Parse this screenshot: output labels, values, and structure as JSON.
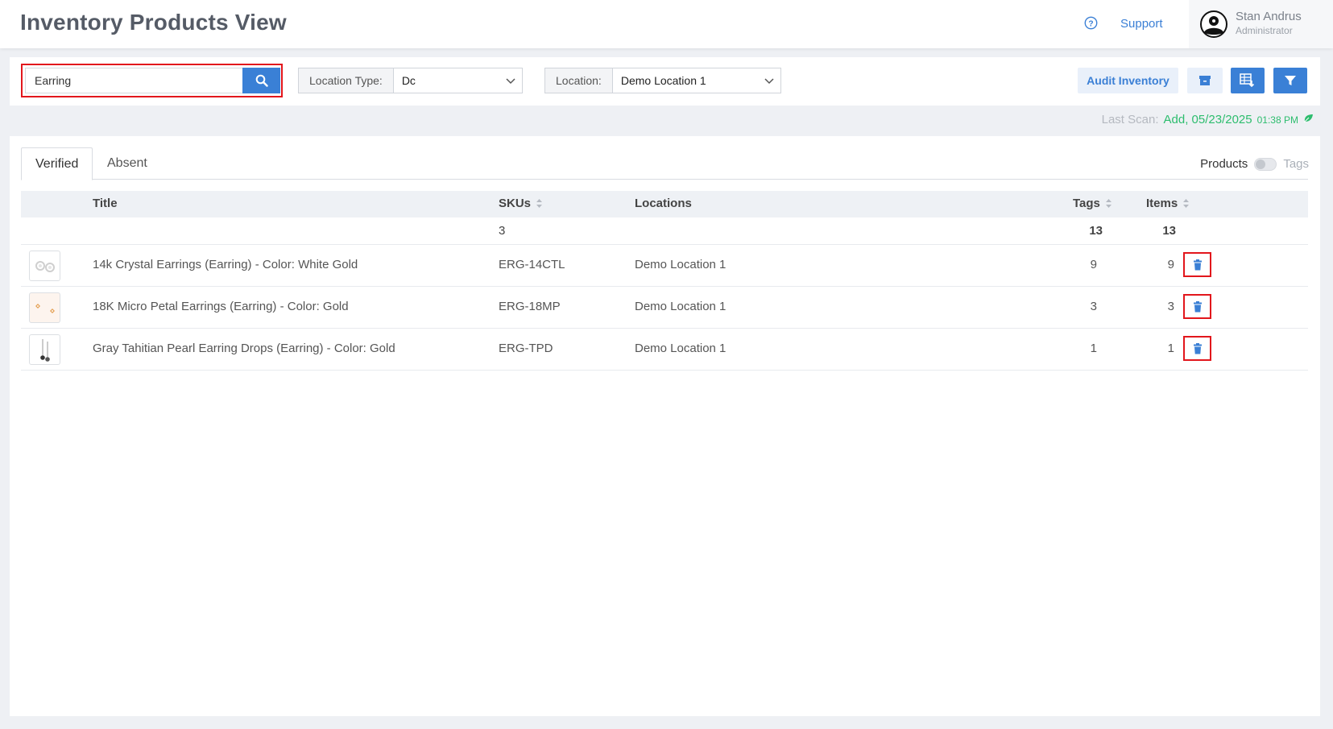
{
  "header": {
    "title": "Inventory Products View",
    "support_label": "Support",
    "user": {
      "name": "Stan Andrus",
      "role": "Administrator"
    }
  },
  "toolbar": {
    "search": {
      "value": "Earring",
      "placeholder": ""
    },
    "location_type": {
      "label": "Location Type:",
      "value": "Dc"
    },
    "location": {
      "label": "Location:",
      "value": "Demo Location 1"
    },
    "audit_label": "Audit Inventory"
  },
  "last_scan": {
    "label": "Last Scan:",
    "value": "Add, 05/23/2025",
    "time": "01:38 PM"
  },
  "tabs": [
    {
      "label": "Verified"
    },
    {
      "label": "Absent"
    }
  ],
  "view_toggle": {
    "left": "Products",
    "right": "Tags"
  },
  "table": {
    "columns": {
      "title": "Title",
      "skus": "SKUs",
      "locations": "Locations",
      "tags": "Tags",
      "items": "Items"
    },
    "totals": {
      "skus": "3",
      "tags": "13",
      "items": "13"
    },
    "rows": [
      {
        "title": "14k Crystal Earrings (Earring) - Color: White Gold",
        "sku": "ERG-14CTL",
        "location": "Demo Location 1",
        "tags": "9",
        "items": "9"
      },
      {
        "title": "18K Micro Petal Earrings (Earring) - Color: Gold",
        "sku": "ERG-18MP",
        "location": "Demo Location 1",
        "tags": "3",
        "items": "3"
      },
      {
        "title": "Gray Tahitian Pearl Earring Drops (Earring) - Color: Gold",
        "sku": "ERG-TPD",
        "location": "Demo Location 1",
        "tags": "1",
        "items": "1"
      }
    ]
  },
  "colors": {
    "accent": "#3a80d6",
    "success": "#2dbd6e",
    "highlight": "#e2161c"
  }
}
